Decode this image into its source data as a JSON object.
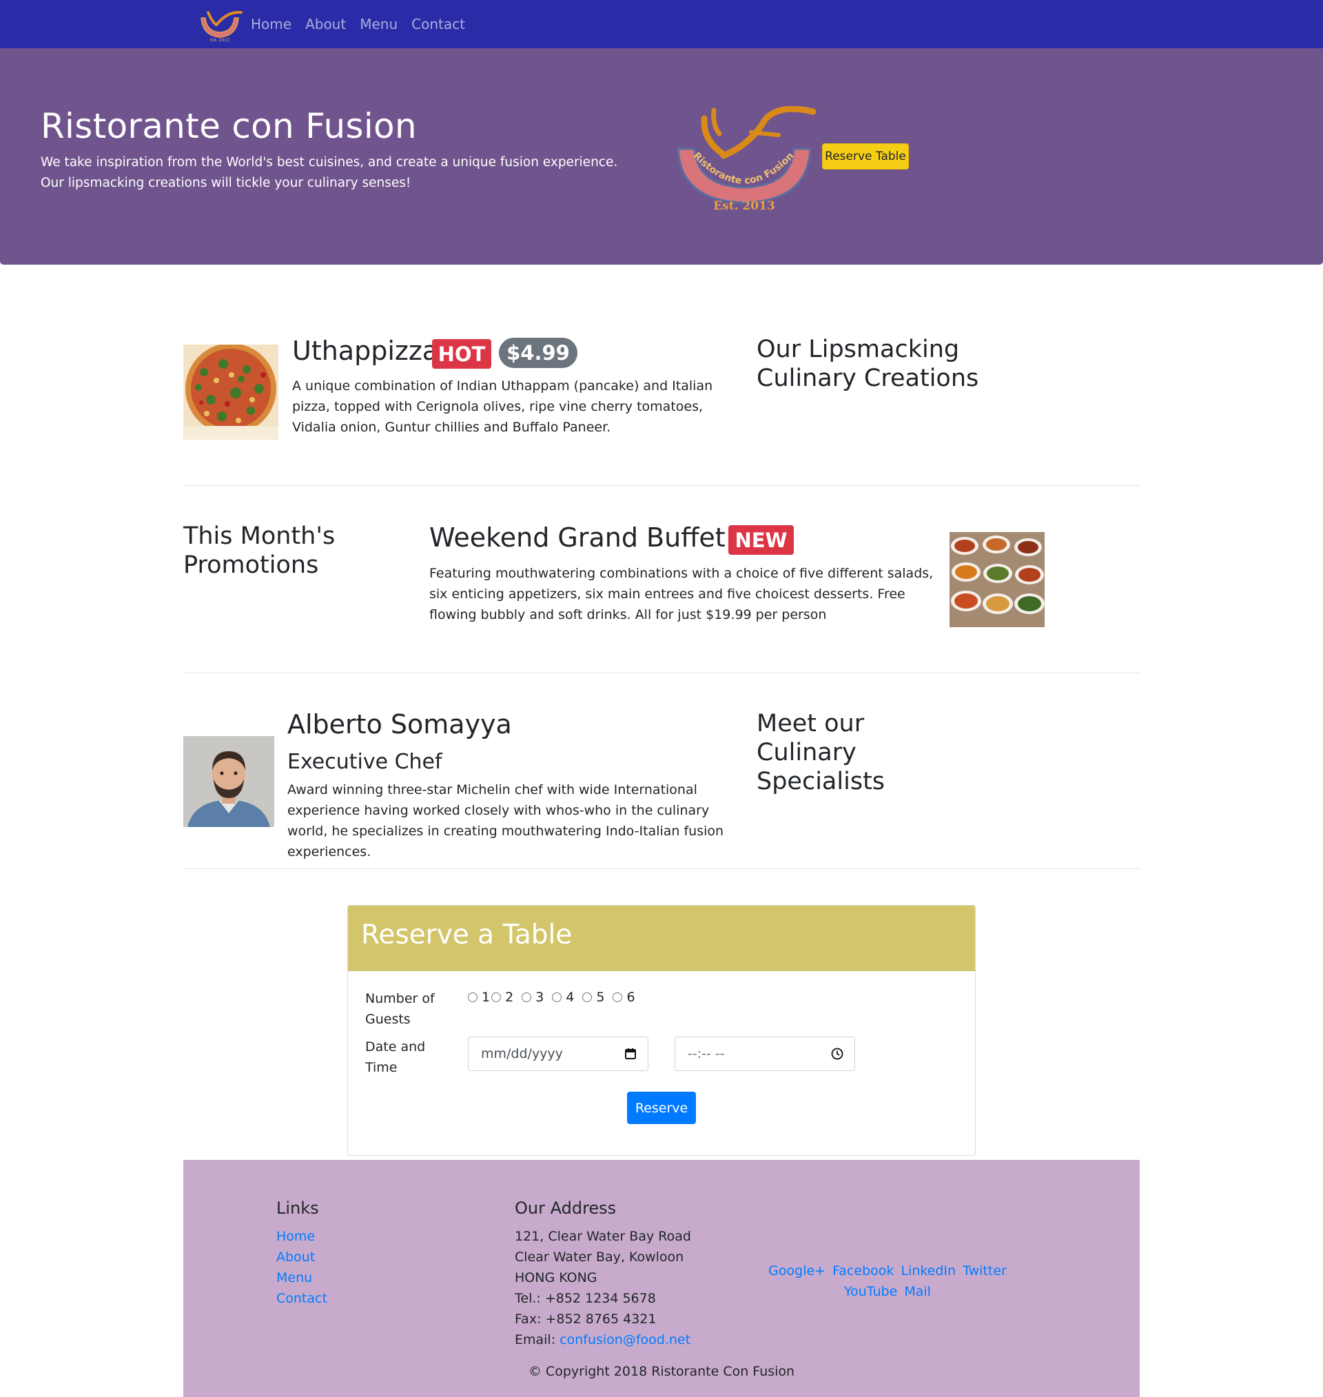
{
  "navbar": {
    "logo_alt": "Ristorante con Fusion logo",
    "links": [
      "Home",
      "About",
      "Menu",
      "Contact"
    ]
  },
  "jumbotron": {
    "title": "Ristorante con Fusion",
    "text": "We take inspiration from the World's best cuisines, and create a unique fusion experience. Our lipsmacking creations will tickle your culinary senses!",
    "logo_text": "Ristorante con Fusion",
    "logo_est": "Est. 2013",
    "reserve_button": "Reserve Table"
  },
  "dish": {
    "title": "Uthappizza",
    "badge": "HOT",
    "price": "$4.99",
    "description": "A unique combination of Indian Uthappam (pancake) and Italian pizza, topped with Cerignola olives, ripe vine cherry tomatoes, Vidalia onion, Guntur chillies and Buffalo Paneer.",
    "side_heading": "Our Lipsmacking Culinary Creations"
  },
  "promotion": {
    "side_heading": "This Month's Promotions",
    "title": "Weekend Grand Buffet",
    "badge": "NEW",
    "description": "Featuring mouthwatering combinations with a choice of five different salads, six enticing appetizers, six main entrees and five choicest desserts. Free flowing bubbly and soft drinks. All for just $19.99 per person"
  },
  "leader": {
    "name": "Alberto Somayya",
    "designation": "Executive Chef",
    "description": "Award winning three-star Michelin chef with wide International experience having worked closely with whos-who in the culinary world, he specializes in creating mouthwatering Indo-Italian fusion experiences.",
    "side_heading": "Meet our Culinary Specialists"
  },
  "reserve": {
    "title": "Reserve a Table",
    "guests_label": "Number of Guests",
    "guest_options": [
      "1",
      "2",
      "3",
      "4",
      "5",
      "6"
    ],
    "datetime_label": "Date and Time",
    "date_placeholder": "mm/dd/yyyy",
    "time_placeholder": "--:-- --",
    "submit": "Reserve"
  },
  "footer": {
    "links_heading": "Links",
    "links": [
      "Home",
      "About",
      "Menu",
      "Contact"
    ],
    "address_heading": "Our Address",
    "address_lines": [
      "121, Clear Water Bay Road",
      "Clear Water Bay, Kowloon",
      "HONG KONG",
      "Tel.: +852 1234 5678",
      "Fax: +852 8765 4321"
    ],
    "email_label": "Email: ",
    "email": "confusion@food.net",
    "social": [
      "Google+",
      "Facebook",
      "LinkedIn",
      "Twitter",
      "YouTube",
      "Mail"
    ],
    "copyright": "© Copyright 2018 Ristorante Con Fusion"
  },
  "colors": {
    "navbar": "#2a2ca7",
    "jumbotron": "#70548d",
    "reserve_header": "#d3c569",
    "footer": "#c8abcc",
    "link": "#007bff",
    "badge_hot": "#dc3545",
    "badge_price": "#6c757d",
    "cta_yellow": "#f6ce16"
  }
}
